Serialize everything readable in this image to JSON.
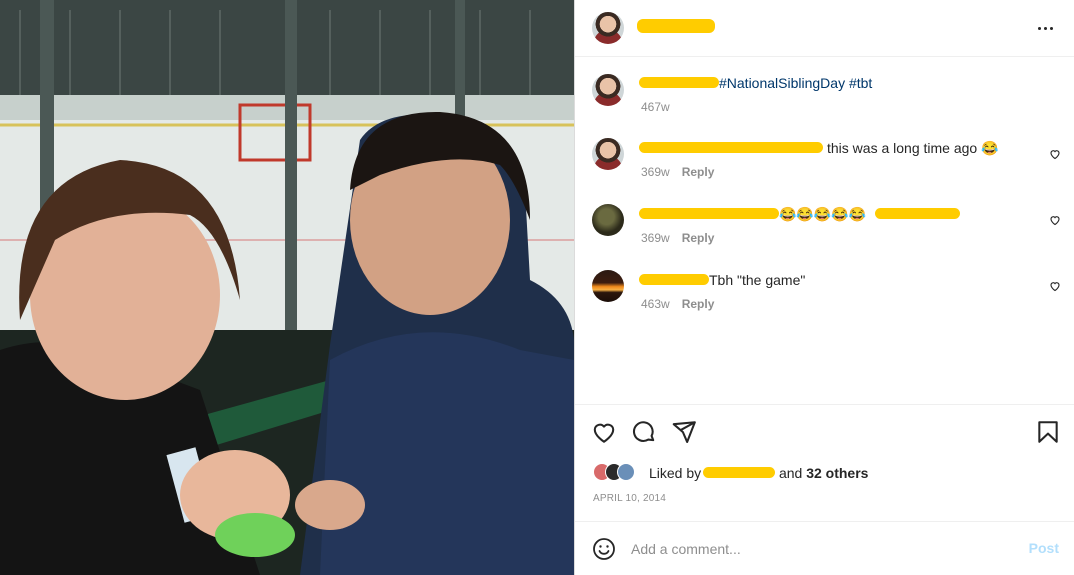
{
  "post": {
    "author_username": "",
    "caption_hashtags": "#NationalSiblingDay #tbt",
    "caption_age": "467w"
  },
  "comments": [
    {
      "text": "this was a long time ago 😂",
      "age": "369w",
      "reply_label": "Reply"
    },
    {
      "text": "😂😂😂😂😂",
      "age": "369w",
      "reply_label": "Reply"
    },
    {
      "text": "Tbh \"the game\"",
      "age": "463w",
      "reply_label": "Reply"
    }
  ],
  "likes": {
    "prefix": "Liked by",
    "conjunction": "and",
    "others": "32 others"
  },
  "date": "APRIL 10, 2014",
  "add_comment": {
    "placeholder": "Add a comment...",
    "post_label": "Post"
  },
  "colors": {
    "redaction": "#ffcc00",
    "hashtag": "#00376b",
    "post_disabled": "#b2dffc",
    "muted": "#8e8e8e"
  },
  "icons": [
    "more-icon",
    "heart-icon",
    "comment-icon",
    "share-icon",
    "bookmark-icon",
    "emoji-icon"
  ]
}
